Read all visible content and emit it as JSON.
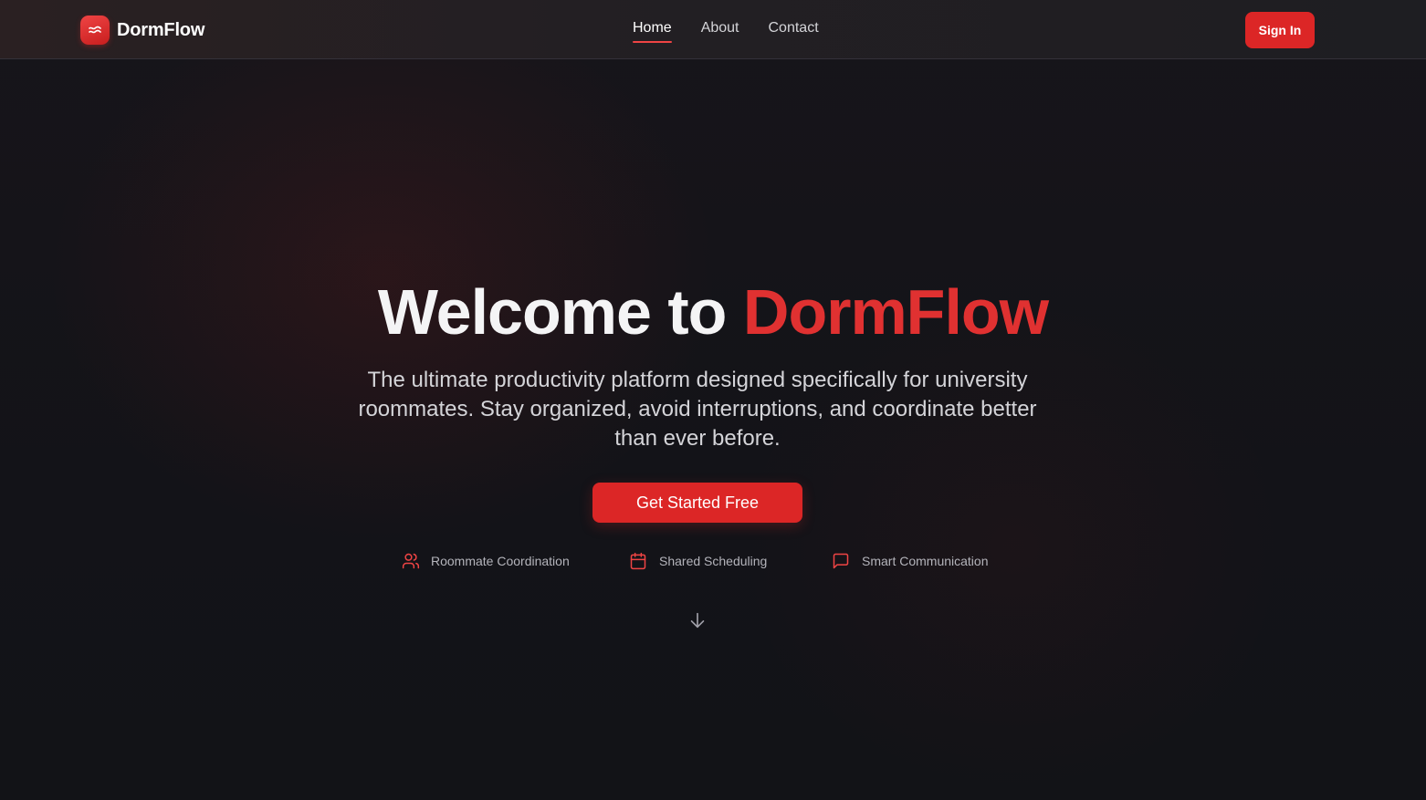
{
  "nav": {
    "brand_name": "DormFlow",
    "links": [
      {
        "label": "Home",
        "active": true
      },
      {
        "label": "About",
        "active": false
      },
      {
        "label": "Contact",
        "active": false
      }
    ],
    "signin_label": "Sign In"
  },
  "hero": {
    "title_prefix": "Welcome to ",
    "title_accent": "DormFlow",
    "subtitle": "The ultimate productivity platform designed specifically for university roommates. Stay organized, avoid interruptions, and coordinate better than ever before.",
    "cta_label": "Get Started Free",
    "features": [
      {
        "icon": "users-icon",
        "label": "Roommate Coordination"
      },
      {
        "icon": "calendar-icon",
        "label": "Shared Scheduling"
      },
      {
        "icon": "message-square-icon",
        "label": "Smart Communication"
      }
    ],
    "scroll_icon": "arrow-down-icon"
  },
  "colors": {
    "accent": "#dc2626",
    "accent_text": "#e03131",
    "background": "#131317",
    "text_primary": "#f4f4f5",
    "text_secondary": "#d4d4d8",
    "text_muted": "#b4b4bb"
  }
}
